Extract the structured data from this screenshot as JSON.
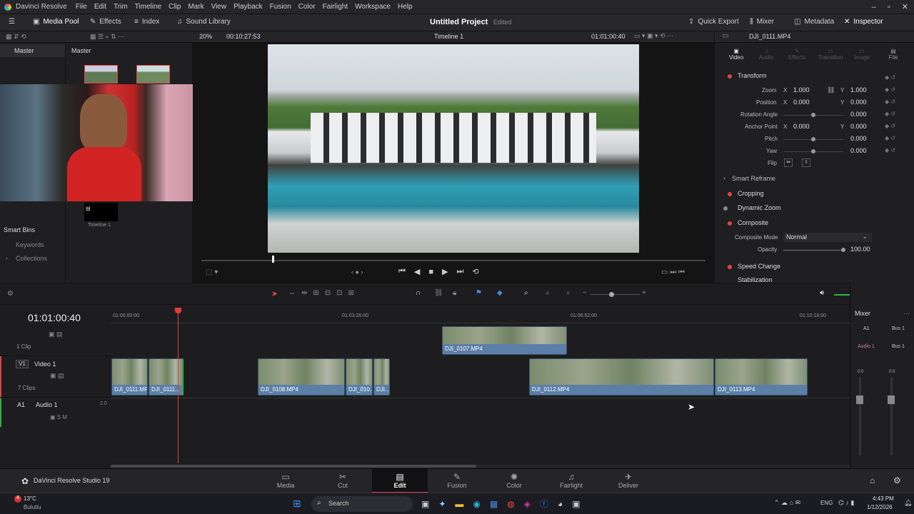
{
  "app": {
    "logo_text": "Davinci Resolve",
    "menu": [
      "File",
      "Edit",
      "Trim",
      "Timeline",
      "Clip",
      "Mark",
      "View",
      "Playback",
      "Fusion",
      "Color",
      "Fairlight",
      "Workspace",
      "Help"
    ]
  },
  "toolbar": {
    "media_pool": "Media Pool",
    "effects": "Effects",
    "index": "Index",
    "sound_library": "Sound Library",
    "project_title": "Untitled Project",
    "project_status": "Edited",
    "quick_export": "Quick Export",
    "mixer": "Mixer",
    "metadata": "Metadata",
    "inspector": "Inspector"
  },
  "mediapool": {
    "master_bin": "Master",
    "master_header": "Master",
    "smart_bins": "Smart Bins",
    "keywords": "Keywords",
    "collections": "Collections",
    "timeline_item": "Timeline 1"
  },
  "viewer": {
    "zoom": "20%",
    "source_tc": "00:10:27:53",
    "timeline_name": "Timeline 1",
    "record_tc": "01:01:00:40",
    "playhead_fraction": 0.14
  },
  "inspector": {
    "clip_name": "DJI_0111.MP4",
    "tabs": [
      "Video",
      "Audio",
      "Effects",
      "Transition",
      "Image",
      "File"
    ],
    "transform": "Transform",
    "zoom_label": "Zoom",
    "zoom_x": "1.000",
    "zoom_y": "1.000",
    "position_label": "Position",
    "position_x": "0.000",
    "position_y": "0.000",
    "rotation_label": "Rotation Angle",
    "rotation": "0.000",
    "anchor_label": "Anchor Point",
    "anchor_x": "0.000",
    "anchor_y": "0.000",
    "pitch_label": "Pitch",
    "pitch": "0.000",
    "yaw_label": "Yaw",
    "yaw": "0.000",
    "flip_label": "Flip",
    "smart_reframe": "Smart Reframe",
    "cropping": "Cropping",
    "dynamic_zoom": "Dynamic Zoom",
    "composite": "Composite",
    "composite_mode_label": "Composite Mode",
    "composite_mode": "Normal",
    "opacity_label": "Opacity",
    "opacity": "100.00",
    "speed_change": "Speed Change",
    "stabilization": "Stabilization",
    "x": "X",
    "y": "Y"
  },
  "timeline": {
    "timecode": "01:01:00:40",
    "ruler": [
      "01:00:00:00",
      "01:03:26:00",
      "01:06:52:00",
      "01:10:18:00"
    ],
    "v2_count": "1 Clip",
    "v1_id": "V1",
    "v1_name": "Video 1",
    "v1_count": "7 Clips",
    "a1_id": "A1",
    "a1_name": "Audio 1",
    "a1_level": "2.0",
    "clips_v2": [
      {
        "name": "DJI_0107.MP4"
      }
    ],
    "clips_v1": [
      {
        "name": "DJI_0111.MP4"
      },
      {
        "name": "DJI_0111..."
      },
      {
        "name": "DJI_0108.MP4"
      },
      {
        "name": "DJI_010..."
      },
      {
        "name": "DJI..."
      },
      {
        "name": "DJI_0112.MP4"
      },
      {
        "name": "DJI_0113.MP4"
      }
    ]
  },
  "mixer": {
    "title": "Mixer",
    "a1": "A1",
    "bus1": "Bus 1",
    "audio1": "Audio 1",
    "bus1b": "Bus 1",
    "left_level": "0.0",
    "right_level": "0.0"
  },
  "pages": [
    "Media",
    "Cut",
    "Edit",
    "Fusion",
    "Color",
    "Fairlight",
    "Deliver"
  ],
  "brand_footer": "DaVinci Resolve Studio 19",
  "taskbar": {
    "temp": "13°C",
    "weather": "Bulutlu",
    "search": "Search",
    "lang": "ENG",
    "time": "4:43 PM",
    "date": "1/12/2026"
  },
  "colors": {
    "accent_red": "#e24444",
    "clip_blue": "#5b7fa6",
    "playhead": "#e23c3c"
  }
}
